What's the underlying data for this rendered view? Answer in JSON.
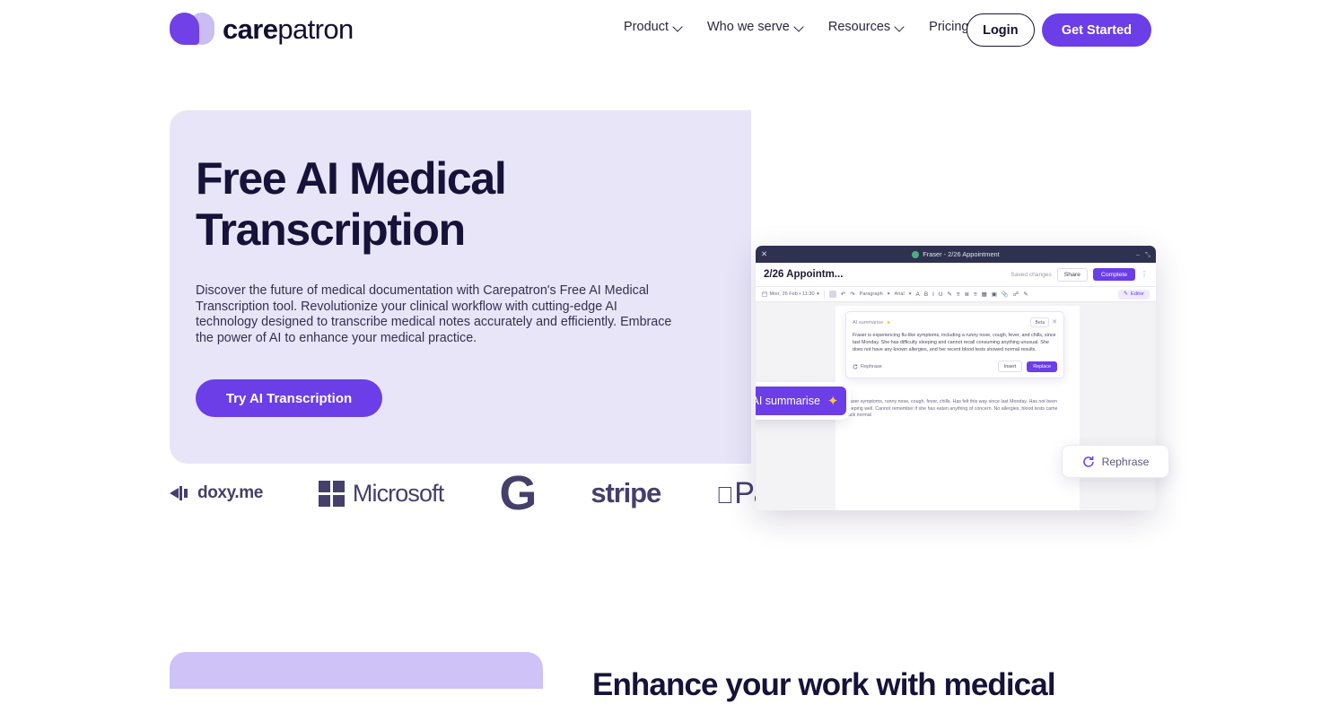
{
  "brand": {
    "name_bold": "care",
    "name_light": "patron",
    "accent": "#6b3ee8",
    "hero_bg": "#e8e5f8",
    "ink": "#161239"
  },
  "nav": {
    "links": [
      {
        "label": "Product",
        "has_caret": true
      },
      {
        "label": "Who we serve",
        "has_caret": true
      },
      {
        "label": "Resources",
        "has_caret": true
      },
      {
        "label": "Pricing",
        "has_caret": false
      }
    ],
    "login_label": "Login",
    "get_started_label": "Get Started"
  },
  "hero": {
    "title_line1": "Free AI Medical",
    "title_line2": "Transcription",
    "paragraph": "Discover the future of medical documentation with Carepatron's Free AI Medical Transcription tool. Revolutionize your clinical workflow with cutting-edge AI technology designed to transcribe medical notes accurately and efficiently. Embrace the power of AI to enhance your medical practice.",
    "cta_label": "Try AI Transcription"
  },
  "logo_strip": [
    {
      "name": "doxy.me",
      "icon": "speaker-icon"
    },
    {
      "name": "Microsoft",
      "icon": "microsoft-squares-icon"
    },
    {
      "name": "G",
      "icon": "google-g-icon"
    },
    {
      "name": "stripe",
      "icon": "stripe-wordmark"
    },
    {
      "name": "Pay",
      "icon": "apple-logo-icon"
    }
  ],
  "app_mockup": {
    "titlebar": {
      "close": "✕",
      "title": "Fraser - 2/26 Appointment",
      "minimize": "‒",
      "expand": "⤡"
    },
    "header": {
      "doc_title": "2/26 Appointm...",
      "saved_status": "Saved changes",
      "share_label": "Share",
      "complete_label": "Complete",
      "kebab": "⋮"
    },
    "toolbar": {
      "date_chip": "Mon, 26 Feb • 11:30",
      "undo": "↶",
      "redo": "↷",
      "paragraph_select": "Paragraph",
      "font_select": "Arial",
      "bold": "B",
      "italic": "I",
      "underline": "U",
      "editor_label": "Editor"
    },
    "ai_card": {
      "label": "AI summarise",
      "badge": "Beta",
      "close": "✕",
      "summary": "Fraser is experiencing flu-like symptoms, including a runny nose, cough, fever, and chills, since last Monday. She has difficulty sleeping and cannot recall consuming anything unusual. She does not have any known allergies, and her recent blood tests showed normal results.",
      "rephrase_label": "Rephrase",
      "insert_label": "Insert",
      "replace_label": "Replace"
    },
    "doc_note": "Fraser symptoms, runny nose, cough, fever, chills. Has felt this way since last Monday. Has not been sleeping well. Cannot remember if she has eaten anything of concern. No allergies, blood tests came back normal",
    "ai_summarise_pill": "AI summarise"
  },
  "floating": {
    "rephrase_label": "Rephrase"
  },
  "lower_section": {
    "heading": "Enhance your work with medical"
  }
}
